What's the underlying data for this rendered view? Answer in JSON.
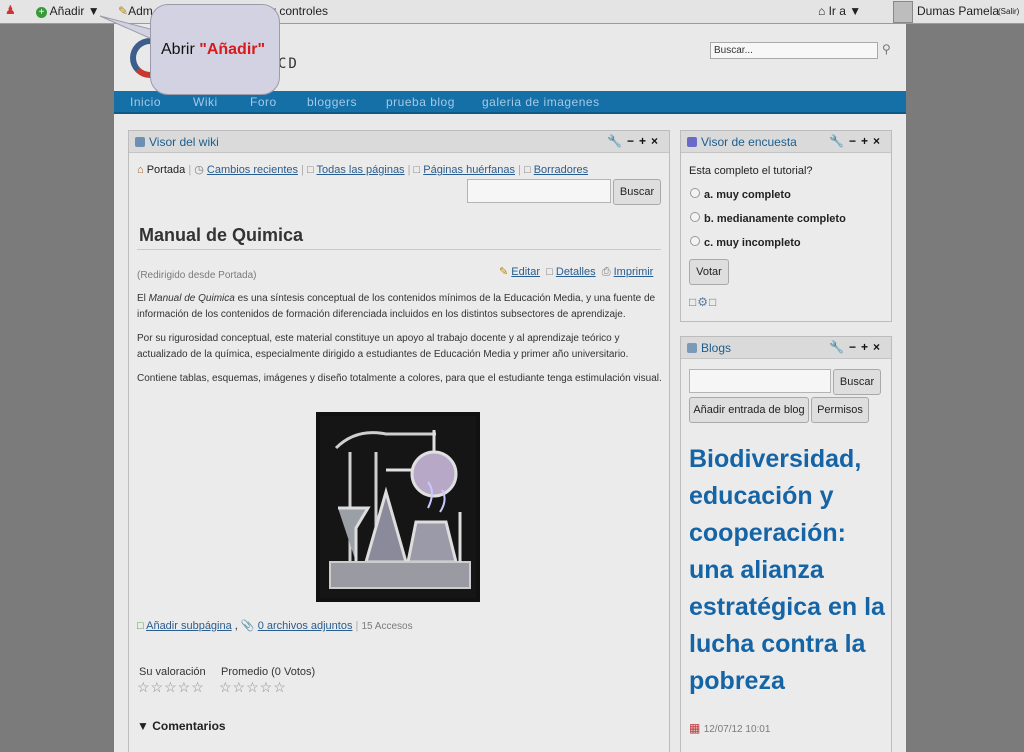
{
  "dock": {
    "add": "Añadir",
    "manage_prefix": "Adm",
    "controls": "r controles",
    "goto": "Ir a",
    "user": "Dumas Pamela",
    "logout": "(Salir)"
  },
  "tooltip": {
    "prefix": "Abrir",
    "target": "\"Añadir\""
  },
  "header": {
    "logo_text": "CD",
    "search_value": "Buscar..."
  },
  "nav": [
    "Inicio",
    "Wiki",
    "Foro",
    "bloggers",
    "prueba blog",
    "galeria de imagenes"
  ],
  "wiki": {
    "title": "Visor del wiki",
    "tabs": [
      "Portada",
      "Cambios recientes",
      "Todas las páginas",
      "Páginas huérfanas",
      "Borradores"
    ],
    "search_button": "Buscar",
    "page_title": "Manual de Quimica",
    "redirect": "(Redirigido desde Portada)",
    "actions": [
      "Editar",
      "Detalles",
      "Imprimir"
    ],
    "p1_pre": "El ",
    "p1_em": "Manual de Quimica",
    "p1_post": " es una síntesis conceptual de los contenidos mínimos de la Educación Media, y una fuente de información de los contenidos de formación diferenciada incluidos en los distintos subsectores de aprendizaje.",
    "p2": "Por su rigurosidad conceptual, este material constituye un apoyo al trabajo docente y al aprendizaje teórico y actualizado de la química, especialmente dirigido a estudiantes de Educación Media y primer año universitario.",
    "p3": "Contiene tablas, esquemas, imágenes y diseño totalmente a colores, para que el estudiante tenga estimulación visual.",
    "add_subpage": "Añadir subpágina",
    "attachments": "0 archivos adjuntos",
    "views": "15 Accesos",
    "your_rating": "Su valoración",
    "average": "Promedio (0 Votos)",
    "comments": "Comentarios"
  },
  "poll": {
    "title": "Visor de encuesta",
    "question": "Esta completo el tutorial?",
    "options": [
      "a. muy completo",
      "b. medianamente completo",
      "c. muy incompleto"
    ],
    "vote": "Votar"
  },
  "blogs": {
    "title": "Blogs",
    "search_button": "Buscar",
    "add_entry": "Añadir entrada de blog",
    "permissions": "Permisos",
    "post_title": "Biodiversidad, educación y cooperación: una alianza estratégica en la lucha contra la pobreza",
    "date": "12/07/12 10:01"
  },
  "colors": {
    "nav_bg": "#1570a8",
    "link": "#2a5d8f",
    "blog_title": "#1564a6",
    "tooltip_accent": "#d91a1a"
  },
  "icons": [
    "add-icon",
    "edit-icon",
    "home-icon",
    "clock-icon",
    "page-icon",
    "printer-icon",
    "attachment-icon",
    "wrench-icon",
    "search-icon",
    "calendar-icon",
    "chart-icon",
    "blog-icon"
  ]
}
